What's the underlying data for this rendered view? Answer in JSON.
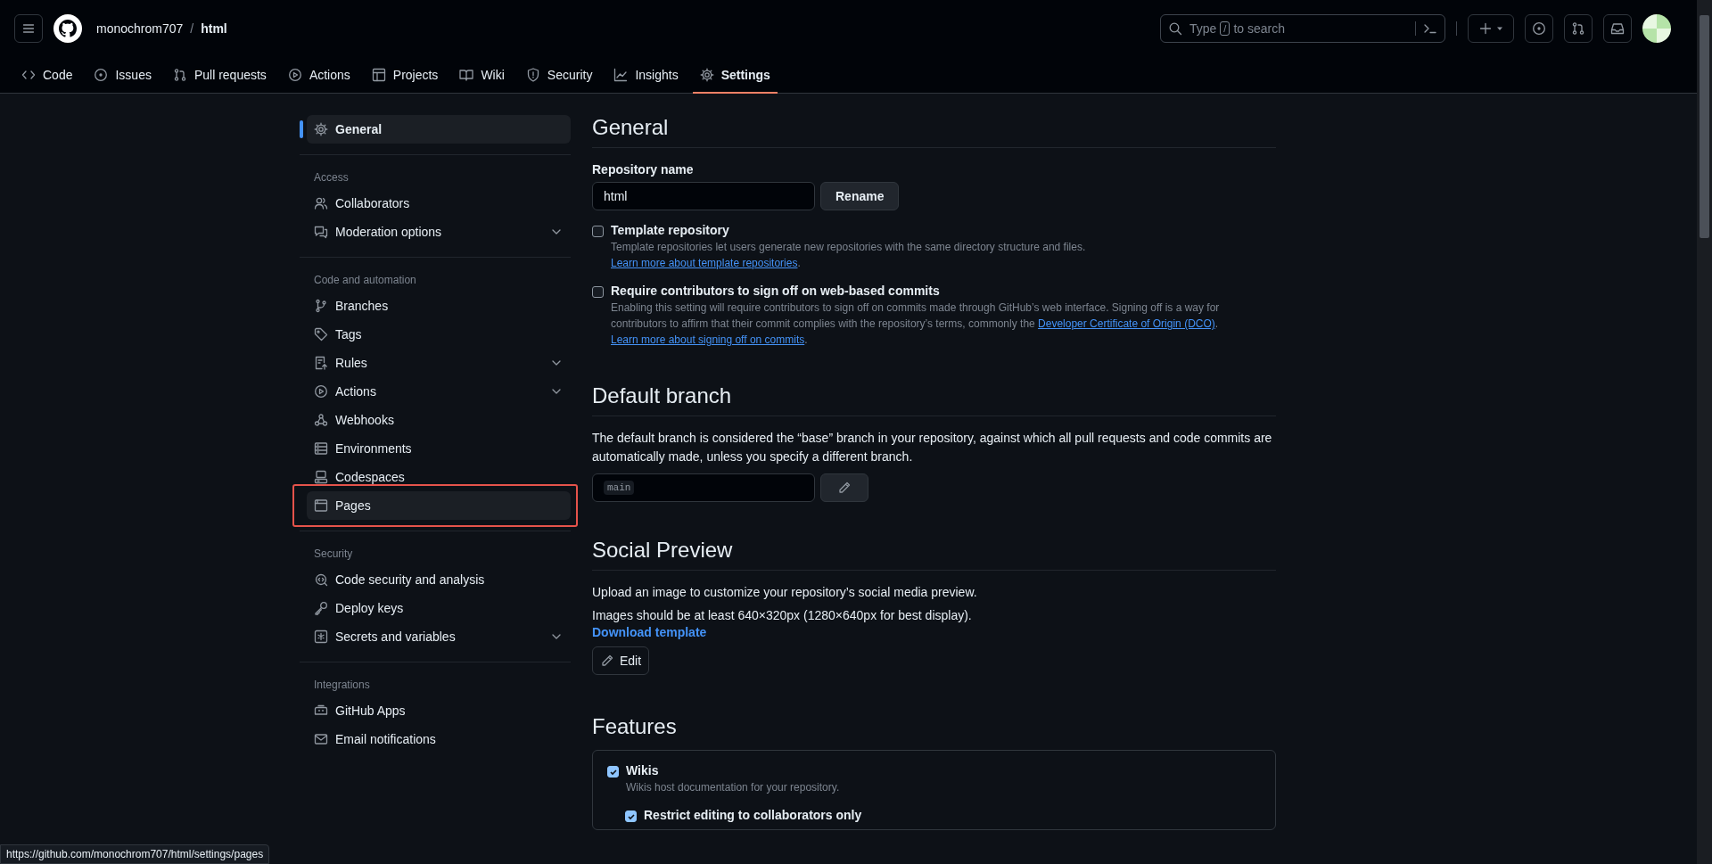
{
  "header": {
    "owner": "monochrom707",
    "separator": "/",
    "repo": "html",
    "search": {
      "placeholder_before": "Type",
      "key": "/",
      "placeholder_after": "to search"
    }
  },
  "tabs": [
    {
      "label": "Code",
      "selected": false
    },
    {
      "label": "Issues",
      "selected": false
    },
    {
      "label": "Pull requests",
      "selected": false
    },
    {
      "label": "Actions",
      "selected": false
    },
    {
      "label": "Projects",
      "selected": false
    },
    {
      "label": "Wiki",
      "selected": false
    },
    {
      "label": "Security",
      "selected": false
    },
    {
      "label": "Insights",
      "selected": false
    },
    {
      "label": "Settings",
      "selected": true
    }
  ],
  "sidebar": {
    "sections": [
      {
        "items": [
          {
            "label": "General",
            "selected": true,
            "expandable": false,
            "highlighted": false
          }
        ]
      },
      {
        "heading": "Access",
        "items": [
          {
            "label": "Collaborators",
            "selected": false,
            "expandable": false,
            "highlighted": false
          },
          {
            "label": "Moderation options",
            "selected": false,
            "expandable": true,
            "highlighted": false
          }
        ]
      },
      {
        "heading": "Code and automation",
        "items": [
          {
            "label": "Branches",
            "selected": false,
            "expandable": false,
            "highlighted": false
          },
          {
            "label": "Tags",
            "selected": false,
            "expandable": false,
            "highlighted": false
          },
          {
            "label": "Rules",
            "selected": false,
            "expandable": true,
            "highlighted": false
          },
          {
            "label": "Actions",
            "selected": false,
            "expandable": true,
            "highlighted": false
          },
          {
            "label": "Webhooks",
            "selected": false,
            "expandable": false,
            "highlighted": false
          },
          {
            "label": "Environments",
            "selected": false,
            "expandable": false,
            "highlighted": false
          },
          {
            "label": "Codespaces",
            "selected": false,
            "expandable": false,
            "highlighted": false
          },
          {
            "label": "Pages",
            "selected": false,
            "expandable": false,
            "highlighted": true
          }
        ]
      },
      {
        "heading": "Security",
        "items": [
          {
            "label": "Code security and analysis",
            "selected": false,
            "expandable": false,
            "highlighted": false
          },
          {
            "label": "Deploy keys",
            "selected": false,
            "expandable": false,
            "highlighted": false
          },
          {
            "label": "Secrets and variables",
            "selected": false,
            "expandable": true,
            "highlighted": false
          }
        ]
      },
      {
        "heading": "Integrations",
        "items": [
          {
            "label": "GitHub Apps",
            "selected": false,
            "expandable": false,
            "highlighted": false
          },
          {
            "label": "Email notifications",
            "selected": false,
            "expandable": false,
            "highlighted": false
          }
        ]
      }
    ]
  },
  "general": {
    "title": "General",
    "repo_name_label": "Repository name",
    "repo_name_value": "html",
    "rename_button": "Rename",
    "options": [
      {
        "label": "Template repository",
        "checked": false,
        "description": [
          {
            "kind": "text",
            "text": "Template repositories let users generate new repositories with the same directory structure and files. "
          },
          {
            "kind": "link",
            "text": "Learn more about template repositories"
          },
          {
            "kind": "text",
            "text": "."
          }
        ]
      },
      {
        "label": "Require contributors to sign off on web-based commits",
        "checked": false,
        "description": [
          {
            "kind": "text",
            "text": "Enabling this setting will require contributors to sign off on commits made through GitHub’s web interface. Signing off is a way for contributors to affirm that their commit complies with the repository’s terms, commonly the "
          },
          {
            "kind": "link",
            "text": "Developer Certificate of Origin (DCO)"
          },
          {
            "kind": "text",
            "text": ". "
          },
          {
            "kind": "link",
            "text": "Learn more about signing off on commits"
          },
          {
            "kind": "text",
            "text": "."
          }
        ]
      }
    ]
  },
  "default_branch": {
    "title": "Default branch",
    "description": "The default branch is considered the “base” branch in your repository, against which all pull requests and code commits are automatically made, unless you specify a different branch.",
    "branch": "main"
  },
  "social_preview": {
    "title": "Social Preview",
    "text": "Upload an image to customize your repository’s social media preview.",
    "size_note": "Images should be at least 640×320px (1280×640px for best display).",
    "template_link": "Download template",
    "edit_button": "Edit"
  },
  "features": {
    "title": "Features",
    "options": [
      {
        "label": "Wikis",
        "checked": true,
        "description": "Wikis host documentation for your repository.",
        "children": [
          {
            "label": "Restrict editing to collaborators only",
            "checked": true
          }
        ]
      }
    ]
  },
  "status_bar": {
    "url": "https://github.com/monochrom707/html/settings/pages"
  }
}
